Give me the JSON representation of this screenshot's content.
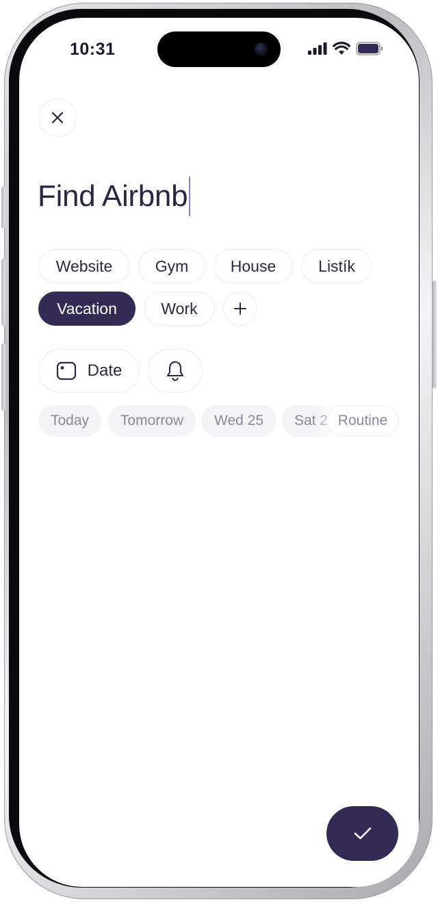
{
  "status_bar": {
    "time": "10:31"
  },
  "task": {
    "title": "Find Airbnb"
  },
  "tags": {
    "items": [
      {
        "label": "Website",
        "selected": false
      },
      {
        "label": "Gym",
        "selected": false
      },
      {
        "label": "House",
        "selected": false
      },
      {
        "label": "Listík",
        "selected": false
      },
      {
        "label": "Vacation",
        "selected": true
      },
      {
        "label": "Work",
        "selected": false
      }
    ],
    "add_icon": "plus-icon"
  },
  "actions": {
    "date_label": "Date",
    "date_icon": "calendar-icon",
    "reminder_icon": "bell-icon"
  },
  "date_suggestions": {
    "items": [
      "Today",
      "Tomorrow",
      "Wed 25",
      "Sat 2"
    ],
    "routine_label": "Routine"
  },
  "fab": {
    "icon": "checkmark-icon"
  },
  "colors": {
    "accent": "#332b55",
    "text": "#2a2745",
    "muted_text": "#8a889a",
    "chip_border": "#ececf0",
    "chip_muted_bg": "#f4f4f6"
  }
}
